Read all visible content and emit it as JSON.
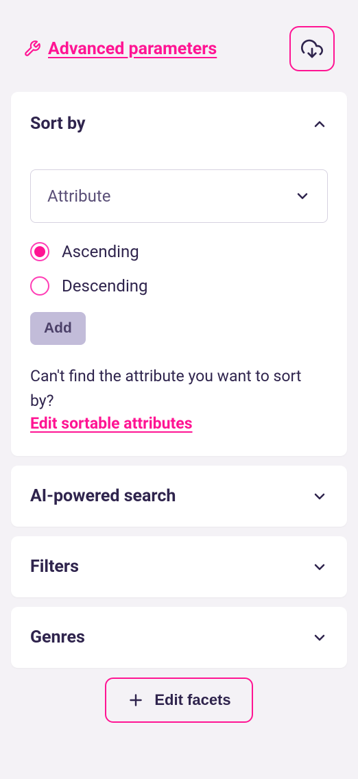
{
  "header": {
    "advanced_params_label": "Advanced parameters"
  },
  "sections": {
    "sort_by": {
      "title": "Sort by",
      "attribute_placeholder": "Attribute",
      "ascending_label": "Ascending",
      "descending_label": "Descending",
      "selected_order": "ascending",
      "add_label": "Add",
      "help_text": "Can't find the attribute you want to sort by?",
      "edit_link_label": "Edit sortable attributes"
    },
    "ai_search": {
      "title": "AI-powered search"
    },
    "filters": {
      "title": "Filters"
    },
    "genres": {
      "title": "Genres"
    }
  },
  "footer": {
    "edit_facets_label": "Edit facets"
  }
}
